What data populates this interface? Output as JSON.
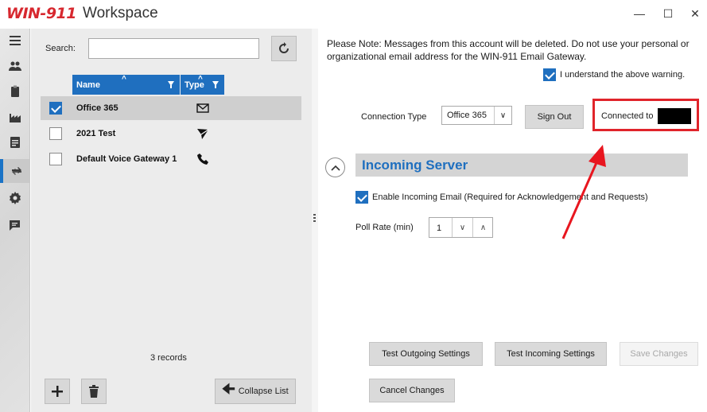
{
  "window": {
    "logo": "WIN-911",
    "title": "Workspace",
    "minimize_glyph": "—",
    "maximize_glyph": "☐",
    "close_glyph": "✕"
  },
  "rail": {
    "items": [
      {
        "icon": "hamburger-menu-icon"
      },
      {
        "icon": "users-icon"
      },
      {
        "icon": "clipboard-icon"
      },
      {
        "icon": "factory-icon"
      },
      {
        "icon": "report-icon"
      },
      {
        "icon": "sync-arrows-icon",
        "active": true
      },
      {
        "icon": "gear-icon"
      },
      {
        "icon": "chat-edit-icon"
      }
    ]
  },
  "list": {
    "search_label": "Search:",
    "search_value": "",
    "columns": {
      "name": "Name",
      "type": "Type"
    },
    "rows": [
      {
        "name": "Office 365",
        "type_icon": "email-icon",
        "checked": true
      },
      {
        "name": "2021 Test",
        "type_icon": "send-paper-plane-icon",
        "checked": false
      },
      {
        "name": "Default Voice Gateway 1",
        "type_icon": "phone-icon",
        "checked": false
      }
    ],
    "records": "3 records",
    "collapse_label": "Collapse List"
  },
  "detail": {
    "note": "Please Note: Messages from this account will be deleted. Do not use your personal or organizational email address for the WIN-911 Email Gateway.",
    "understand_label": "I understand the above warning.",
    "connection_type_label": "Connection Type",
    "connection_type_value": "Office 365",
    "sign_out_label": "Sign Out",
    "connected_label": "Connected to",
    "section_title": "Incoming Server",
    "enable_incoming_label": "Enable Incoming Email (Required for Acknowledgement and Requests)",
    "poll_rate_label": "Poll Rate (min)",
    "poll_rate_value": "1",
    "buttons": {
      "test_outgoing": "Test Outgoing Settings",
      "test_incoming": "Test Incoming Settings",
      "save": "Save Changes",
      "cancel": "Cancel Changes"
    }
  },
  "colors": {
    "accent": "#1f6fbf",
    "brand_red": "#d7282f",
    "annotation_red": "#e0242b"
  }
}
